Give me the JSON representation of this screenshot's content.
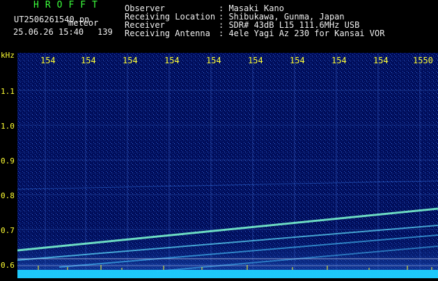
{
  "header": {
    "app_title": "HROFFT",
    "filename": "UT2506261540.pn",
    "event_type": "meteor",
    "datetime": "25.06.26 15:40",
    "count": "139"
  },
  "station_info": [
    {
      "key": "Observer",
      "value": ": Masaki Kano"
    },
    {
      "key": "Receiving Location",
      "value": ": Shibukawa, Gunma, Japan"
    },
    {
      "key": "Receiver",
      "value": ": SDR# 43dB L15 111.6MHz USB"
    },
    {
      "key": "Receiving Antenna",
      "value": ": 4ele Yagi Az 230 for Kansai VOR"
    }
  ],
  "axes": {
    "y_unit": "kHz",
    "y_ticks": [
      "1.1",
      "1.0",
      "0.9",
      "0.8",
      "0.7",
      "0.6"
    ],
    "x_ticks": [
      "154",
      "154",
      "154",
      "154",
      "154",
      "154",
      "154",
      "154",
      "154",
      "1550"
    ]
  },
  "colors": {
    "background": "#000d5a",
    "signal": "#7fffd4",
    "noise_floor": "#1fd0ff",
    "text_green": "#3cff3c",
    "text_yellow": "#ffff33"
  }
}
